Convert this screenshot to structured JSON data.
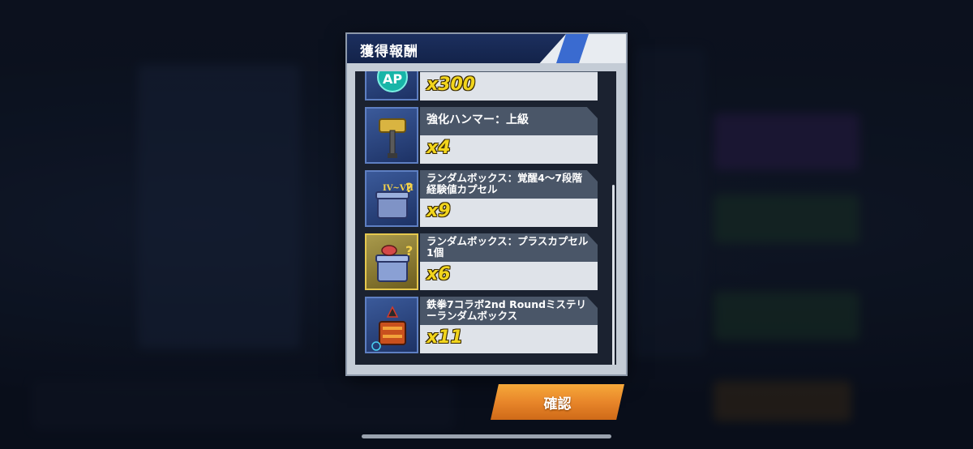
{
  "dialog": {
    "title": "獲得報酬",
    "items": [
      {
        "name": "",
        "quantity": "x300",
        "icon": "ap-token-icon"
      },
      {
        "name": "強化ハンマー：上級",
        "quantity": "x4",
        "icon": "hammer-icon"
      },
      {
        "name": "ランダムボックス：覚醒4〜7段階経験値カプセル",
        "quantity": "x9",
        "icon": "random-box-capsule-icon"
      },
      {
        "name": "ランダムボックス：プラスカプセル1個",
        "quantity": "x6",
        "icon": "plus-capsule-box-icon"
      },
      {
        "name": "鉄拳7コラボ2nd Roundミステリーランダムボックス",
        "quantity": "x11",
        "icon": "mystery-box-icon"
      }
    ]
  },
  "confirm_button": {
    "label": "確認"
  },
  "colors": {
    "header_band": "#13234a",
    "accent": "#3a6bd0",
    "quantity_text": "#f2d51c",
    "confirm_button": "#e8862a"
  }
}
